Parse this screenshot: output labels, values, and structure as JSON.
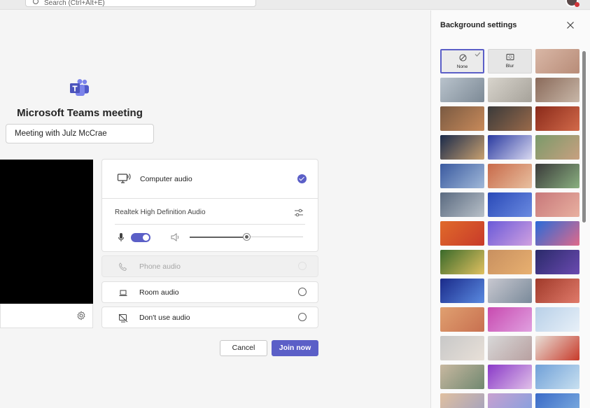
{
  "search": {
    "placeholder": "Search (Ctrl+Alt+E)"
  },
  "meeting": {
    "title": "Microsoft Teams meeting",
    "name_value": "Meeting with Julz McCrae"
  },
  "audio": {
    "computer_audio_label": "Computer audio",
    "device_name": "Realtek High Definition Audio",
    "mic_on": true,
    "speaker_volume": 0.5,
    "phone_audio_label": "Phone audio",
    "room_audio_label": "Room audio",
    "no_audio_label": "Don't use audio",
    "selected": "Computer audio"
  },
  "actions": {
    "cancel_label": "Cancel",
    "join_label": "Join now"
  },
  "background_panel": {
    "title": "Background settings",
    "options": [
      {
        "label": "None",
        "selected": true
      },
      {
        "label": "Blur",
        "selected": false
      }
    ],
    "images": [
      "#d9b7a6,#b88c78",
      "#b9c3cc,#7d8a96",
      "#d8d4cc,#a6a29a",
      "#8a6a5a,#c8b7a8",
      "#7a5a42,#c88a5a",
      "#3a3a3a,#9a6a4a",
      "#8a2a1a,#d26a4a",
      "#1a2a4a,#c8a070",
      "#2a3aa0,#d8d8f0",
      "#7a9a6a,#c8a080",
      "#3a5aa0,#a0b8d8",
      "#c86a4a,#e8c0a0",
      "#3a3a3a,#8ab080",
      "#5a6a80,#b8c0c8",
      "#2a4ab8,#6a8ae0",
      "#c8787a,#e8b0a0",
      "#e06a2a,#c83a2a",
      "#6a5ad8,#d0a0e0",
      "#2a6ad8,#e06a8a",
      "#3a6a2a,#e0c060",
      "#c89060,#e8b070",
      "#2a2a6a,#6a4ab0",
      "#1a2a8a,#5a8ae0",
      "#c8c8d0,#7a8a9a",
      "#a03a2a,#e07a6a",
      "#e0a070,#c87050",
      "#c84ab0,#e0a0e0",
      "#b8d0e8,#e8f0f8",
      "#c8c8c8,#e8e0d8",
      "#d8d8d8,#b8a0a0",
      "#e8e0d8,#c83a2a",
      "#c8b8a0,#708870",
      "#8a3ac8,#e0c0e8",
      "#70a0d8,#c8e0f0",
      "#e0c0a0,#a0a0c0",
      "#c8a0d0,#80a0e0",
      "#3a6ac8,#80b0e0"
    ]
  }
}
